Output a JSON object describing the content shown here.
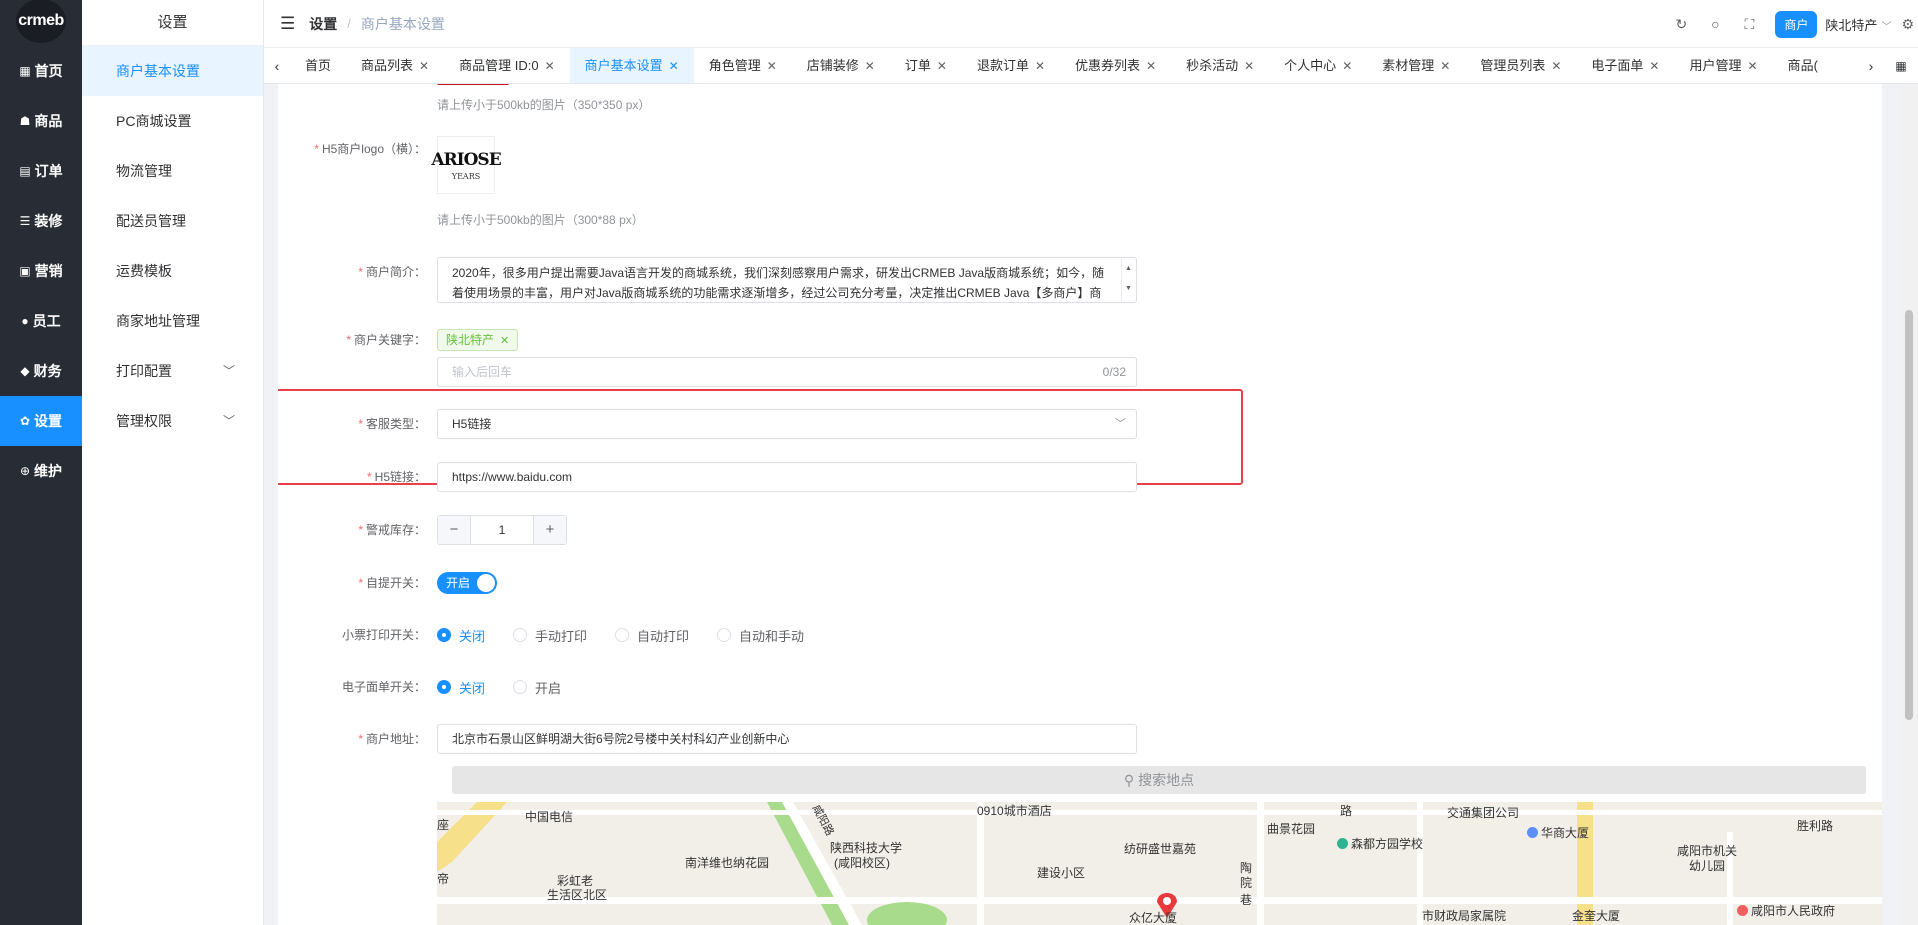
{
  "rail": {
    "logo": "crmeb",
    "items": [
      {
        "icon": "grid-icon",
        "glyph": "▦",
        "label": "首页"
      },
      {
        "icon": "bag-icon",
        "glyph": "☗",
        "label": "商品"
      },
      {
        "icon": "order-icon",
        "glyph": "▤",
        "label": "订单"
      },
      {
        "icon": "sliders-icon",
        "glyph": "☰",
        "label": "装修"
      },
      {
        "icon": "marketing-icon",
        "glyph": "▣",
        "label": "营销"
      },
      {
        "icon": "user-icon",
        "glyph": "●",
        "label": "员工"
      },
      {
        "icon": "wallet-icon",
        "glyph": "◆",
        "label": "财务"
      },
      {
        "icon": "gear-icon",
        "glyph": "✿",
        "label": "设置"
      },
      {
        "icon": "maintain-icon",
        "glyph": "⊕",
        "label": "维护"
      }
    ]
  },
  "submenu": {
    "title": "设置",
    "items": [
      {
        "label": "商户基本设置"
      },
      {
        "label": "PC商城设置"
      },
      {
        "label": "物流管理"
      },
      {
        "label": "配送员管理"
      },
      {
        "label": "运费模板"
      },
      {
        "label": "商家地址管理"
      },
      {
        "label": "打印配置"
      },
      {
        "label": "管理权限"
      }
    ]
  },
  "header": {
    "crumb1": "设置",
    "crumb_sep": "/",
    "crumb2": "商户基本设置",
    "badge": "商户",
    "merchant": "陕北特产"
  },
  "tabs": [
    {
      "label": "首页"
    },
    {
      "label": "商品列表"
    },
    {
      "label": "商品管理 ID:0"
    },
    {
      "label": "商户基本设置"
    },
    {
      "label": "角色管理"
    },
    {
      "label": "店铺装修"
    },
    {
      "label": "订单"
    },
    {
      "label": "退款订单"
    },
    {
      "label": "优惠券列表"
    },
    {
      "label": "秒杀活动"
    },
    {
      "label": "个人中心"
    },
    {
      "label": "素材管理"
    },
    {
      "label": "管理员列表"
    },
    {
      "label": "电子面单"
    },
    {
      "label": "用户管理"
    },
    {
      "label": "商品("
    }
  ],
  "form": {
    "hint1": "请上传小于500kb的图片（350*350 px）",
    "logo_label": "H5商户logo（横）：",
    "logo_line1": "ARIOSE",
    "logo_line2": "YEARS",
    "hint2": "请上传小于500kb的图片（300*88 px）",
    "intro_label": "商户简介：",
    "intro_value": "2020年，很多用户提出需要Java语言开发的商城系统，我们深刻感察用户需求，研发出CRMEB Java版商城系统；如今，随着使用场景的丰富，用户对Java版商城系统的功能需求逐渐增多，经过公司充分考量，决定推出CRMEB Java【多商户】商城系统，以满足更多的使用需求。",
    "keyword_label": "商户关键字：",
    "keyword_tag": "陕北特产",
    "keyword_placeholder": "输入后回车",
    "keyword_count": "0/32",
    "service_label": "客服类型：",
    "service_value": "H5链接",
    "h5_label": "H5链接：",
    "h5_value": "https://www.baidu.com",
    "stock_label": "警戒库存：",
    "stock_minus": "−",
    "stock_value": "1",
    "stock_plus": "+",
    "pickup_label": "自提开关：",
    "pickup_switch": "开启",
    "receipt_label": "小票打印开关：",
    "receipt_options": [
      "关闭",
      "手动打印",
      "自动打印",
      "自动和手动"
    ],
    "ebill_label": "电子面单开关：",
    "ebill_options": [
      "关闭",
      "开启"
    ],
    "address_label": "商户地址：",
    "address_value": "北京市石景山区鲜明湖大街6号院2号楼中关村科幻产业创新中心",
    "map_search": "搜索地点"
  },
  "map": {
    "labels": [
      "中国电信",
      "0910城市酒店",
      "曲景花园",
      "交通集团公司",
      "胜利路",
      "华商大厦",
      "陕西科技大学",
      "(咸阳校区)",
      "纺研盛世嘉苑",
      "森都方园学校",
      "咸阳市机关",
      "幼儿园",
      "彩虹老",
      "生活区北区",
      "南洋维也纳花园",
      "建设小区",
      "市财政局家属院",
      "金奎大厦",
      "咸阳市人民政府",
      "众亿大厦",
      "陶",
      "院",
      "巷",
      "路",
      "帝",
      "座",
      "咸阳路"
    ]
  },
  "colors": {
    "accent": "#1890ff",
    "rail_bg": "#282c34",
    "highlight": "#e8414b",
    "tag_green": "#67c23a"
  }
}
